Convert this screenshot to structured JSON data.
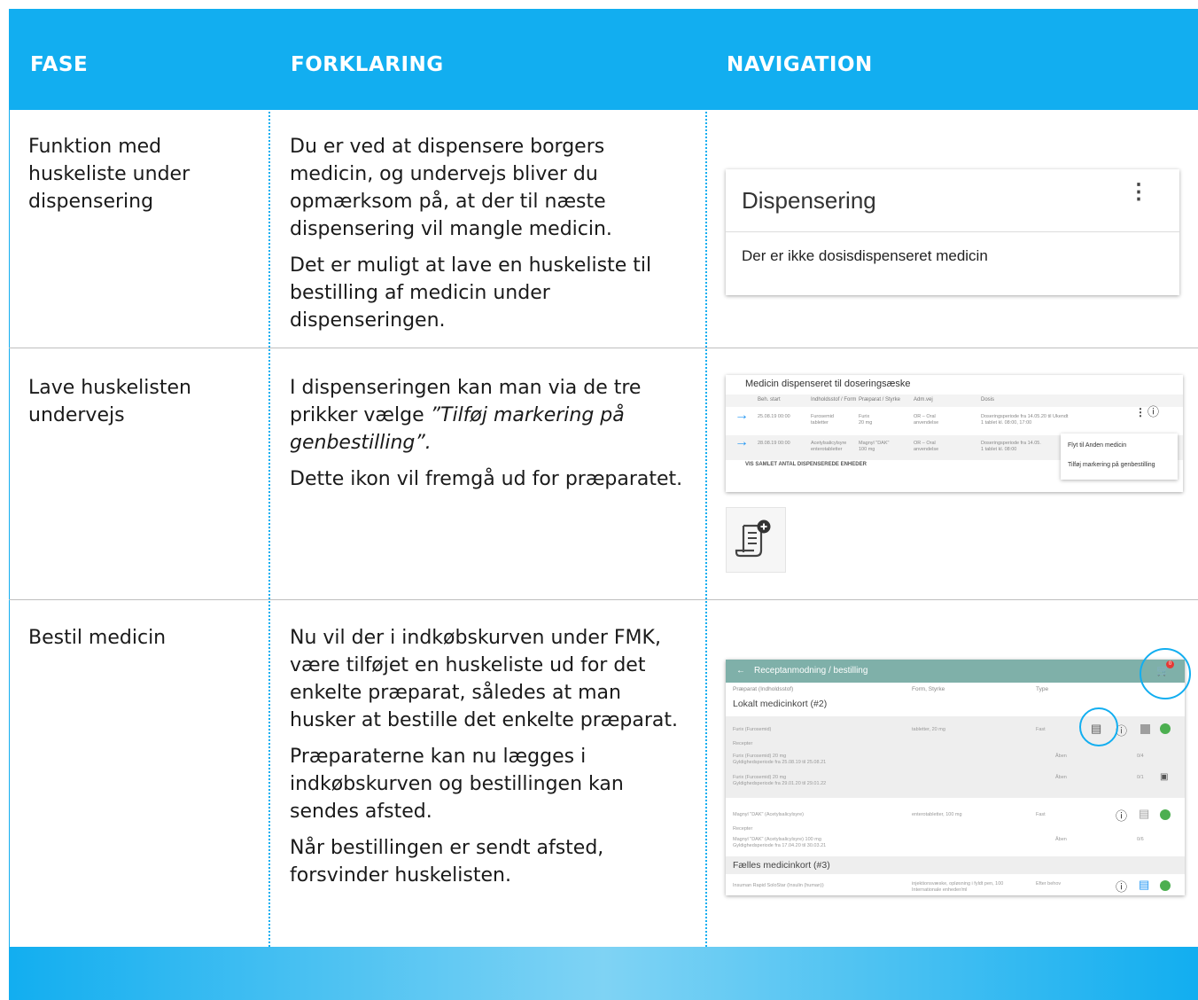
{
  "header": {
    "col1": "FASE",
    "col2": "FORKLARING",
    "col3": "NAVIGATION"
  },
  "rows": [
    {
      "fase": "Funktion med huskeliste under dispensering",
      "p1": "Du er ved at dispensere borgers medicin, og undervejs bliver du opmærksom på, at der til næste dispensering vil mangle medicin.",
      "p2": "Det er muligt at lave en huskeliste til bestilling af medicin under dispenseringen."
    },
    {
      "fase": "Lave huskelisten undervejs",
      "p1_a": "I dispenseringen kan man via de tre prikker vælge ",
      "p1_b": "”Tilføj markering på genbestilling”.",
      "p2": "Dette ikon vil fremgå ud for præparatet."
    },
    {
      "fase": "Bestil medicin",
      "p1": "Nu vil der i indkøbskurven under FMK, være tilføjet en huskeliste ud for det enkelte præparat, således at man husker at bestille det enkelte præparat.",
      "p2": "Præparaterne kan nu lægges i indkøbskurven og bestillingen kan sendes afsted.",
      "p3": "Når bestillingen er sendt afsted, forsvinder huskelisten."
    }
  ],
  "shot1": {
    "title": "Dispensering",
    "dots": "⋮",
    "message": "Der er ikke dosisdispenseret medicin"
  },
  "shot2": {
    "title": "Medicin dispenseret til doseringsæske",
    "headers": [
      "Beh. start",
      "Indholdsstof / Form",
      "Præparat / Styrke",
      "Adm.vej",
      "Dosis"
    ],
    "rows": [
      {
        "start": "25.08.19 00:00",
        "stof": "Furosemid",
        "form": "tabletter",
        "praep": "Furix",
        "styrke": "20 mg",
        "admvej": "OR – Oral",
        "adm2": "anvendelse",
        "dosis": "Doseringsperiode fra 14.05.20 til Ukendt",
        "dosis2": "1 tablet kl. 08:00, 17:00"
      },
      {
        "start": "28.08.19 00:00",
        "stof": "Acetylsalicylsyre",
        "form": "enterotabletter",
        "praep": "Magnyl \"DAK\"",
        "styrke": "100 mg",
        "admvej": "OR – Oral",
        "adm2": "anvendelse",
        "dosis": "Doseringsperiode fra 14.05.",
        "dosis2": "1 tablet kl. 08:00"
      }
    ],
    "menu": [
      "Flyt til Anden medicin",
      "Tilføj markering på genbestilling"
    ],
    "footer": "VIS SAMLET ANTAL DISPENSEREDE ENHEDER"
  },
  "shot3": {
    "title": "Receptanmodning / bestilling",
    "back": "←",
    "cart_badge": "0",
    "cols": [
      "Præparat (Indholdsstof)",
      "Form, Styrke",
      "Type"
    ],
    "section1": "Lokalt medicinkort (#2)",
    "furix": {
      "name": "Furix (Furosemid)",
      "form": "tabletter, 20 mg",
      "type": "Fast"
    },
    "recepter": "Recepter",
    "r1": {
      "name": "Furix (Furosemid) 20 mg",
      "period": "Gyldighedsperiode fra 25.08.19 til 25.08.21",
      "status": "Åben",
      "count": "0/4"
    },
    "r2": {
      "name": "Furix (Furosemid) 20 mg",
      "period": "Gyldighedsperiode fra 29.01.20 til 29.01.22",
      "status": "Åben",
      "count": "0/1"
    },
    "magnyl": {
      "name": "Magnyl \"DAK\" (Acetylsalicylsyre)",
      "form": "enterotabletter, 100 mg",
      "type": "Fast"
    },
    "r3": {
      "name": "Magnyl \"DAK\" (Acetylsalicylsyre) 100 mg",
      "period": "Gyldighedsperiode fra 17.04.20 til 30.03.21",
      "status": "Åben",
      "count": "0/6"
    },
    "section2": "Fælles medicinkort (#3)",
    "insulin": {
      "name": "Insuman Rapid SoloStar (Insulin (human))",
      "form": "injektionsvæske, opløsning i fyldt pen, 100",
      "form2": "Internationale enheder/ml",
      "type": "Efter behov"
    }
  },
  "colors": {
    "accent": "#12aef0",
    "teal": "#7fb0a9",
    "green": "#4caf50"
  }
}
